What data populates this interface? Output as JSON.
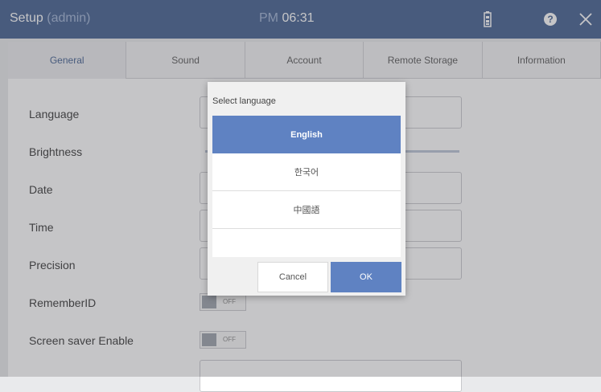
{
  "header": {
    "title": "Setup",
    "title_sub": "(admin)",
    "clock_ampm": "PM",
    "clock_time": "06:31",
    "icons": [
      "battery-icon",
      "help-icon",
      "close-icon"
    ]
  },
  "tabs": [
    {
      "label": "General",
      "active": true
    },
    {
      "label": "Sound"
    },
    {
      "label": "Account"
    },
    {
      "label": "Remote Storage"
    },
    {
      "label": "Information"
    }
  ],
  "settings": {
    "language": "Language",
    "brightness": "Brightness",
    "date": "Date",
    "time": "Time",
    "precision": "Precision",
    "remember_id": "RememberID",
    "screen_saver": "Screen saver Enable",
    "toggle_off": "OFF"
  },
  "dialog": {
    "title": "Select language",
    "options": [
      "English",
      "한국어",
      "中國語"
    ],
    "selected": "English",
    "cancel": "Cancel",
    "ok": "OK"
  },
  "colors": {
    "header_bg": "#3f5d8e",
    "accent": "#5f82c2"
  }
}
